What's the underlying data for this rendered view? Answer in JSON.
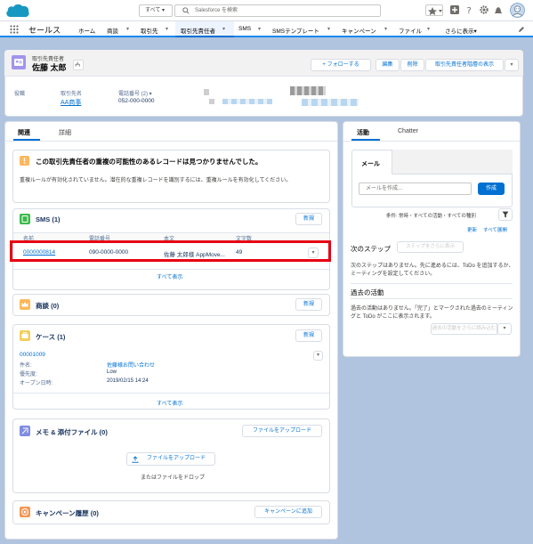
{
  "header": {
    "search_scope": "すべて ▾",
    "search_placeholder": "Salesforce を検索"
  },
  "nav": {
    "app_name": "セールス",
    "items": [
      "ホーム",
      "商談",
      "取引先",
      "取引先責任者",
      "SMS",
      "SMSテンプレート",
      "キャンペーン",
      "ファイル",
      "さらに表示▾"
    ]
  },
  "record": {
    "object_label": "取引先責任者",
    "name": "佐藤 太郎",
    "follow_label": "+ フォローする",
    "edit_label": "編集",
    "delete_label": "削除",
    "dup_label": "取引先責任者階層の表示",
    "fields": {
      "title_label": "役職",
      "account_label": "取引先名",
      "account_value": "AA商事",
      "phone_label": "電話番号 (2) ▾",
      "phone_value": "052-000-0000"
    }
  },
  "tabs": {
    "related": "関連",
    "details": "詳細"
  },
  "duplicate": {
    "title": "この取引先責任者の重複の可能性のあるレコードは見つかりませんでした。",
    "body": "重複ルールが有効化されていません。潜在的な重複レコードを識別するには、重複ルールを有効化してください。"
  },
  "sms": {
    "title": "SMS (1)",
    "new_label": "新規",
    "columns": [
      "名前",
      "電話番号",
      "本文",
      "文字数"
    ],
    "row": {
      "name": "0000000814",
      "phone": "090-0000-0000",
      "body": "佐藤 太郎様 AppMove...",
      "count": "49"
    },
    "view_all": "すべて表示"
  },
  "opportunity": {
    "title": "商談 (0)",
    "new_label": "新規"
  },
  "cases": {
    "title": "ケース (1)",
    "new_label": "新規",
    "case_number": "00001009",
    "subject_label": "件名:",
    "subject_value": "佐藤様お問い合わせ",
    "priority_label": "優先度:",
    "priority_value": "Low",
    "opened_label": "オープン日時:",
    "opened_value": "2019/02/15 14:24",
    "view_all": "すべて表示"
  },
  "files": {
    "title": "メモ & 添付ファイル (0)",
    "upload_label": "ファイルをアップロード",
    "upload_inner": "ファイルをアップロード",
    "drop_label": "またはファイルをドロップ"
  },
  "campaign": {
    "title": "キャンペーン履歴 (0)",
    "add_label": "キャンペーンに追加"
  },
  "activity": {
    "tab_activity": "活動",
    "tab_chatter": "Chatter",
    "mail_tab": "メール",
    "mail_placeholder": "メールを作成...",
    "create_label": "作成",
    "filter_text": "条件: 常時・すべての活動・すべての種別",
    "refresh": "更新",
    "expand": "すべて展開",
    "next_steps_title": "次のステップ",
    "next_steps_more": "ステップをさらに表示",
    "next_steps_body": "次のステップはありません。先に進めるには、ToDo を追加するか、ミーティングを設定してください。",
    "past_title": "過去の活動",
    "past_body": "過去の活動はありません。「完了」とマークされた過去のミーティングと ToDo がここに表示されます。",
    "past_more": "過去の活動をさらに読み込む"
  },
  "colors": {
    "highlight_border": "#e60012",
    "brand": "#1589ee",
    "contact_icon": "#a094ed",
    "sms_icon": "#3bba4c",
    "opportunity_icon": "#fcb95b",
    "case_icon": "#f2cf5b",
    "files_icon": "#7f8de1",
    "campaign_icon": "#f49756"
  }
}
